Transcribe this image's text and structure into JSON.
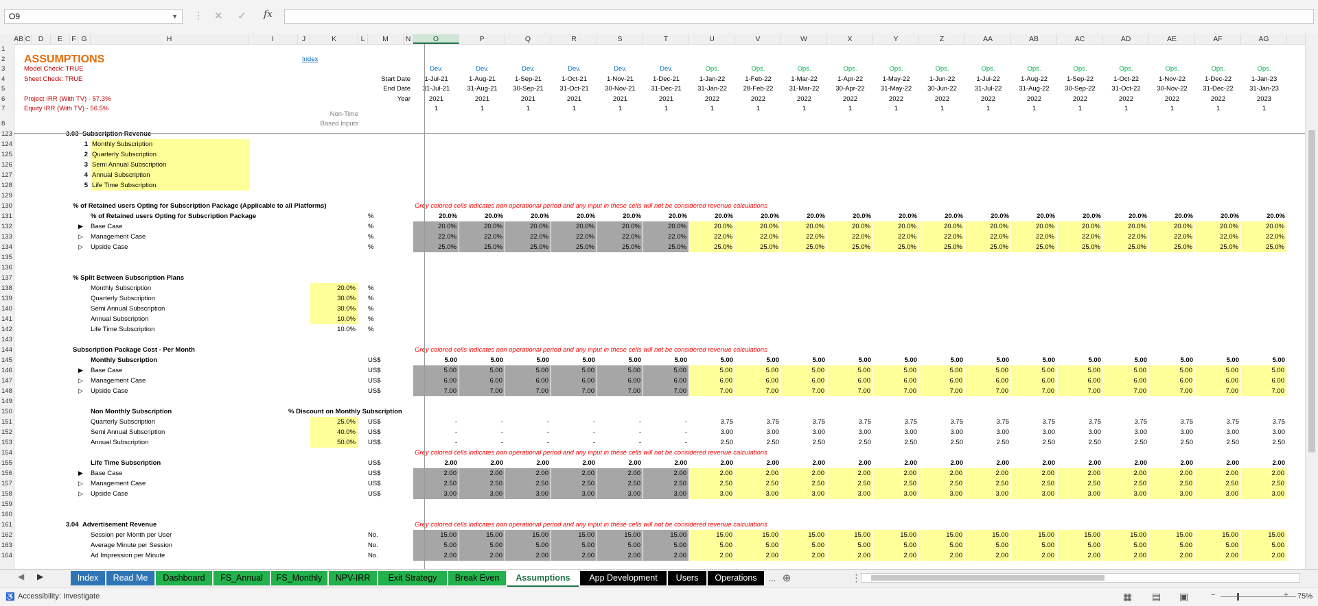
{
  "formula_bar": {
    "name_box": "O9",
    "formula": ""
  },
  "columns": [
    {
      "l": "A",
      "w": 6
    },
    {
      "l": "B",
      "w": 10
    },
    {
      "l": "C",
      "w": 10
    },
    {
      "l": "D",
      "w": 28
    },
    {
      "l": "E",
      "w": 28
    },
    {
      "l": "F",
      "w": 12
    },
    {
      "l": "G",
      "w": 18
    },
    {
      "l": "H",
      "w": 230
    },
    {
      "l": "I",
      "w": 72
    },
    {
      "l": "J",
      "w": 18
    },
    {
      "l": "K",
      "w": 70
    },
    {
      "l": "L",
      "w": 14
    },
    {
      "l": "M",
      "w": 52
    },
    {
      "l": "N",
      "w": 14
    },
    {
      "l": "O",
      "w": 67,
      "sel": true
    },
    {
      "l": "P",
      "w": 67
    },
    {
      "l": "Q",
      "w": 67
    },
    {
      "l": "R",
      "w": 67
    },
    {
      "l": "S",
      "w": 67
    },
    {
      "l": "T",
      "w": 67
    },
    {
      "l": "U",
      "w": 67
    },
    {
      "l": "V",
      "w": 67
    },
    {
      "l": "W",
      "w": 67
    },
    {
      "l": "X",
      "w": 67
    },
    {
      "l": "Y",
      "w": 67
    },
    {
      "l": "Z",
      "w": 67
    },
    {
      "l": "AA",
      "w": 67
    },
    {
      "l": "AB",
      "w": 67
    },
    {
      "l": "AC",
      "w": 67
    },
    {
      "l": "AD",
      "w": 67
    },
    {
      "l": "AE",
      "w": 67
    },
    {
      "l": "AF",
      "w": 67
    },
    {
      "l": "AG",
      "w": 67
    }
  ],
  "header_rows": {
    "title": "ASSUMPTIONS",
    "index_link": "Index",
    "model_check": "Model Check: TRUE",
    "sheet_check": "Sheet Check: TRUE",
    "project_irr": "Project IRR  (With TV) - 57.3%",
    "equity_irr": "Equity IRR  (With TV) - 56.5%",
    "start_label": "Start Date",
    "end_label": "End Date",
    "year_label": "Year",
    "non_time_1": "Non-Time",
    "non_time_2": "Based Inputs",
    "phase": [
      "Dev.",
      "Dev.",
      "Dev.",
      "Dev.",
      "Dev.",
      "Dev.",
      "Ops.",
      "Ops.",
      "Ops.",
      "Ops.",
      "Ops.",
      "Ops.",
      "Ops.",
      "Ops.",
      "Ops.",
      "Ops.",
      "Ops.",
      "Ops.",
      "Ops."
    ],
    "start": [
      "1-Jul-21",
      "1-Aug-21",
      "1-Sep-21",
      "1-Oct-21",
      "1-Nov-21",
      "1-Dec-21",
      "1-Jan-22",
      "1-Feb-22",
      "1-Mar-22",
      "1-Apr-22",
      "1-May-22",
      "1-Jun-22",
      "1-Jul-22",
      "1-Aug-22",
      "1-Sep-22",
      "1-Oct-22",
      "1-Nov-22",
      "1-Dec-22",
      "1-Jan-23"
    ],
    "end": [
      "31-Jul-21",
      "31-Aug-21",
      "30-Sep-21",
      "31-Oct-21",
      "30-Nov-21",
      "31-Dec-21",
      "31-Jan-22",
      "28-Feb-22",
      "31-Mar-22",
      "30-Apr-22",
      "31-May-22",
      "30-Jun-22",
      "31-Jul-22",
      "31-Aug-22",
      "30-Sep-22",
      "31-Oct-22",
      "30-Nov-22",
      "31-Dec-22",
      "31-Jan-23"
    ],
    "year": [
      "2021",
      "2021",
      "2021",
      "2021",
      "2021",
      "2021",
      "2022",
      "2022",
      "2022",
      "2022",
      "2022",
      "2022",
      "2022",
      "2022",
      "2022",
      "2022",
      "2022",
      "2022",
      "2023"
    ],
    "flag": [
      "1",
      "1",
      "1",
      "1",
      "1",
      "1",
      "1",
      "1",
      "1",
      "1",
      "1",
      "1",
      "1",
      "1",
      "1",
      "1",
      "1",
      "1",
      "1"
    ]
  },
  "row_numbers": [
    "1",
    "2",
    "3",
    "4",
    "5",
    "6",
    "7",
    "8",
    "123",
    "124",
    "125",
    "126",
    "127",
    "128",
    "129",
    "130",
    "131",
    "132",
    "133",
    "134",
    "135",
    "136",
    "137",
    "138",
    "139",
    "140",
    "141",
    "142",
    "143",
    "144",
    "145",
    "146",
    "147",
    "148",
    "149",
    "150",
    "151",
    "152",
    "153",
    "154",
    "155",
    "156",
    "157",
    "158",
    "159",
    "160",
    "161",
    "162",
    "163",
    "164"
  ],
  "body": {
    "sec_303": {
      "num": "3.03",
      "label": "Subscription Revenue"
    },
    "plans": [
      {
        "n": "1",
        "label": "Monthly Subscription"
      },
      {
        "n": "2",
        "label": "Quarterly Subscription"
      },
      {
        "n": "3",
        "label": "Semi Annual Subscription"
      },
      {
        "n": "4",
        "label": "Annual Subscription"
      },
      {
        "n": "5",
        "label": "Life Time Subscription"
      }
    ],
    "retained_title": "% of Retained users Opting for Subscription Package (Applicable to all Platforms)",
    "grey_note": "Grey colored cells indicates non operational period and any input in these cells will not be considered revenue calculations",
    "retained_sub": "% of Retained users Opting for Subscription Package",
    "retained_sub_vals": [
      "20.0%",
      "20.0%",
      "20.0%",
      "20.0%",
      "20.0%",
      "20.0%",
      "20.0%",
      "20.0%",
      "20.0%",
      "20.0%",
      "20.0%",
      "20.0%",
      "20.0%",
      "20.0%",
      "20.0%",
      "20.0%",
      "20.0%",
      "20.0%",
      "20.0%"
    ],
    "cases": [
      "Base Case",
      "Management Case",
      "Upside Case"
    ],
    "pct_unit": "%",
    "usd_unit": "US$",
    "no_unit": "No.",
    "retained_cases": [
      [
        "20.0%",
        "20.0%",
        "20.0%",
        "20.0%",
        "20.0%",
        "20.0%",
        "20.0%",
        "20.0%",
        "20.0%",
        "20.0%",
        "20.0%",
        "20.0%",
        "20.0%",
        "20.0%",
        "20.0%",
        "20.0%",
        "20.0%",
        "20.0%",
        "20.0%"
      ],
      [
        "22.0%",
        "22.0%",
        "22.0%",
        "22.0%",
        "22.0%",
        "22.0%",
        "22.0%",
        "22.0%",
        "22.0%",
        "22.0%",
        "22.0%",
        "22.0%",
        "22.0%",
        "22.0%",
        "22.0%",
        "22.0%",
        "22.0%",
        "22.0%",
        "22.0%"
      ],
      [
        "25.0%",
        "25.0%",
        "25.0%",
        "25.0%",
        "25.0%",
        "25.0%",
        "25.0%",
        "25.0%",
        "25.0%",
        "25.0%",
        "25.0%",
        "25.0%",
        "25.0%",
        "25.0%",
        "25.0%",
        "25.0%",
        "25.0%",
        "25.0%",
        "25.0%"
      ]
    ],
    "split_title": "% Split Between Subscription Plans",
    "split": [
      {
        "label": "Monthly Subscription",
        "v": "20.0%"
      },
      {
        "label": "Quarterly Subscription",
        "v": "30.0%"
      },
      {
        "label": "Semi Annual Subscription",
        "v": "30.0%"
      },
      {
        "label": "Annual Subscription",
        "v": "10.0%"
      },
      {
        "label": "Life Time Subscription",
        "v": "10.0%"
      }
    ],
    "cost_title": "Subscription Package Cost - Per Month",
    "monthly_sub": "Monthly Subscription",
    "monthly_vals": [
      "5.00",
      "5.00",
      "5.00",
      "5.00",
      "5.00",
      "5.00",
      "5.00",
      "5.00",
      "5.00",
      "5.00",
      "5.00",
      "5.00",
      "5.00",
      "5.00",
      "5.00",
      "5.00",
      "5.00",
      "5.00",
      "5.00"
    ],
    "monthly_cases": [
      [
        "5.00",
        "5.00",
        "5.00",
        "5.00",
        "5.00",
        "5.00",
        "5.00",
        "5.00",
        "5.00",
        "5.00",
        "5.00",
        "5.00",
        "5.00",
        "5.00",
        "5.00",
        "5.00",
        "5.00",
        "5.00",
        "5.00"
      ],
      [
        "6.00",
        "6.00",
        "6.00",
        "6.00",
        "6.00",
        "6.00",
        "6.00",
        "6.00",
        "6.00",
        "6.00",
        "6.00",
        "6.00",
        "6.00",
        "6.00",
        "6.00",
        "6.00",
        "6.00",
        "6.00",
        "6.00"
      ],
      [
        "7.00",
        "7.00",
        "7.00",
        "7.00",
        "7.00",
        "7.00",
        "7.00",
        "7.00",
        "7.00",
        "7.00",
        "7.00",
        "7.00",
        "7.00",
        "7.00",
        "7.00",
        "7.00",
        "7.00",
        "7.00",
        "7.00"
      ]
    ],
    "nonmonthly_title": "Non Monthly Subscription",
    "discount_label": "% Discount on Monthly Subscription",
    "nonmonthly": [
      {
        "label": "Quarterly Subscription",
        "disc": "25.0%",
        "vals": [
          "-",
          "-",
          "-",
          "-",
          "-",
          "-",
          "3.75",
          "3.75",
          "3.75",
          "3.75",
          "3.75",
          "3.75",
          "3.75",
          "3.75",
          "3.75",
          "3.75",
          "3.75",
          "3.75",
          "3.75"
        ]
      },
      {
        "label": "Semi Annual Subscription",
        "disc": "40.0%",
        "vals": [
          "-",
          "-",
          "-",
          "-",
          "-",
          "-",
          "3.00",
          "3.00",
          "3.00",
          "3.00",
          "3.00",
          "3.00",
          "3.00",
          "3.00",
          "3.00",
          "3.00",
          "3.00",
          "3.00",
          "3.00"
        ]
      },
      {
        "label": "Annual Subscription",
        "disc": "50.0%",
        "vals": [
          "-",
          "-",
          "-",
          "-",
          "-",
          "-",
          "2.50",
          "2.50",
          "2.50",
          "2.50",
          "2.50",
          "2.50",
          "2.50",
          "2.50",
          "2.50",
          "2.50",
          "2.50",
          "2.50",
          "2.50"
        ]
      }
    ],
    "lifetime_title": "Life Time Subscription",
    "lifetime_vals": [
      "2.00",
      "2.00",
      "2.00",
      "2.00",
      "2.00",
      "2.00",
      "2.00",
      "2.00",
      "2.00",
      "2.00",
      "2.00",
      "2.00",
      "2.00",
      "2.00",
      "2.00",
      "2.00",
      "2.00",
      "2.00",
      "2.00"
    ],
    "lifetime_cases": [
      [
        "2.00",
        "2.00",
        "2.00",
        "2.00",
        "2.00",
        "2.00",
        "2.00",
        "2.00",
        "2.00",
        "2.00",
        "2.00",
        "2.00",
        "2.00",
        "2.00",
        "2.00",
        "2.00",
        "2.00",
        "2.00",
        "2.00"
      ],
      [
        "2.50",
        "2.50",
        "2.50",
        "2.50",
        "2.50",
        "2.50",
        "2.50",
        "2.50",
        "2.50",
        "2.50",
        "2.50",
        "2.50",
        "2.50",
        "2.50",
        "2.50",
        "2.50",
        "2.50",
        "2.50",
        "2.50"
      ],
      [
        "3.00",
        "3.00",
        "3.00",
        "3.00",
        "3.00",
        "3.00",
        "3.00",
        "3.00",
        "3.00",
        "3.00",
        "3.00",
        "3.00",
        "3.00",
        "3.00",
        "3.00",
        "3.00",
        "3.00",
        "3.00",
        "3.00"
      ]
    ],
    "sec_304": {
      "num": "3.04",
      "label": "Advertisement Revenue"
    },
    "ad_rows": [
      {
        "label": "Session per Month per User",
        "vals": [
          "15.00",
          "15.00",
          "15.00",
          "15.00",
          "15.00",
          "15.00",
          "15.00",
          "15.00",
          "15.00",
          "15.00",
          "15.00",
          "15.00",
          "15.00",
          "15.00",
          "15.00",
          "15.00",
          "15.00",
          "15.00",
          "15.00"
        ]
      },
      {
        "label": "Average Minute per Session",
        "vals": [
          "5.00",
          "5.00",
          "5.00",
          "5.00",
          "5.00",
          "5.00",
          "5.00",
          "5.00",
          "5.00",
          "5.00",
          "5.00",
          "5.00",
          "5.00",
          "5.00",
          "5.00",
          "5.00",
          "5.00",
          "5.00",
          "5.00"
        ]
      },
      {
        "label": "Ad Impression per Minute",
        "vals": [
          "2.00",
          "2.00",
          "2.00",
          "2.00",
          "2.00",
          "2.00",
          "2.00",
          "2.00",
          "2.00",
          "2.00",
          "2.00",
          "2.00",
          "2.00",
          "2.00",
          "2.00",
          "2.00",
          "2.00",
          "2.00",
          "2.00"
        ]
      }
    ]
  },
  "tabs": [
    {
      "label": "Index",
      "bg": "#2f75b5",
      "fg": "#ffffff",
      "w": 50
    },
    {
      "label": "Read Me",
      "bg": "#2f75b5",
      "fg": "#ffffff",
      "w": 70
    },
    {
      "label": "Dashboard",
      "bg": "#22b14c",
      "fg": "#000000",
      "w": 82
    },
    {
      "label": "FS_Annual",
      "bg": "#22b14c",
      "fg": "#000000",
      "w": 82
    },
    {
      "label": "FS_Monthly",
      "bg": "#22b14c",
      "fg": "#000000",
      "w": 82
    },
    {
      "label": "NPV-IRR",
      "bg": "#22b14c",
      "fg": "#000000",
      "w": 70
    },
    {
      "label": "Exit Strategy",
      "bg": "#22b14c",
      "fg": "#000000",
      "w": 100
    },
    {
      "label": "Break Even",
      "bg": "#22b14c",
      "fg": "#000000",
      "w": 84
    },
    {
      "label": "Assumptions",
      "bg": "#ffffff",
      "fg": "#217346",
      "w": 104,
      "active": true
    },
    {
      "label": "App Development",
      "bg": "#000000",
      "fg": "#ffffff",
      "w": 126
    },
    {
      "label": "Users",
      "bg": "#000000",
      "fg": "#ffffff",
      "w": 56
    },
    {
      "label": "Operations",
      "bg": "#000000",
      "fg": "#ffffff",
      "w": 82
    }
  ],
  "tab_more": "...",
  "status": {
    "accessibility": "Accessibility: Investigate",
    "zoom": "75%"
  },
  "colors": {
    "title": "#e46c0a",
    "red": "#c00000",
    "dev": "#0070c0",
    "ops": "#00b050",
    "grey_note": "#ff0000",
    "grey": "#a6a6a6",
    "yellow": "#ffff99",
    "link": "#0563c1"
  }
}
